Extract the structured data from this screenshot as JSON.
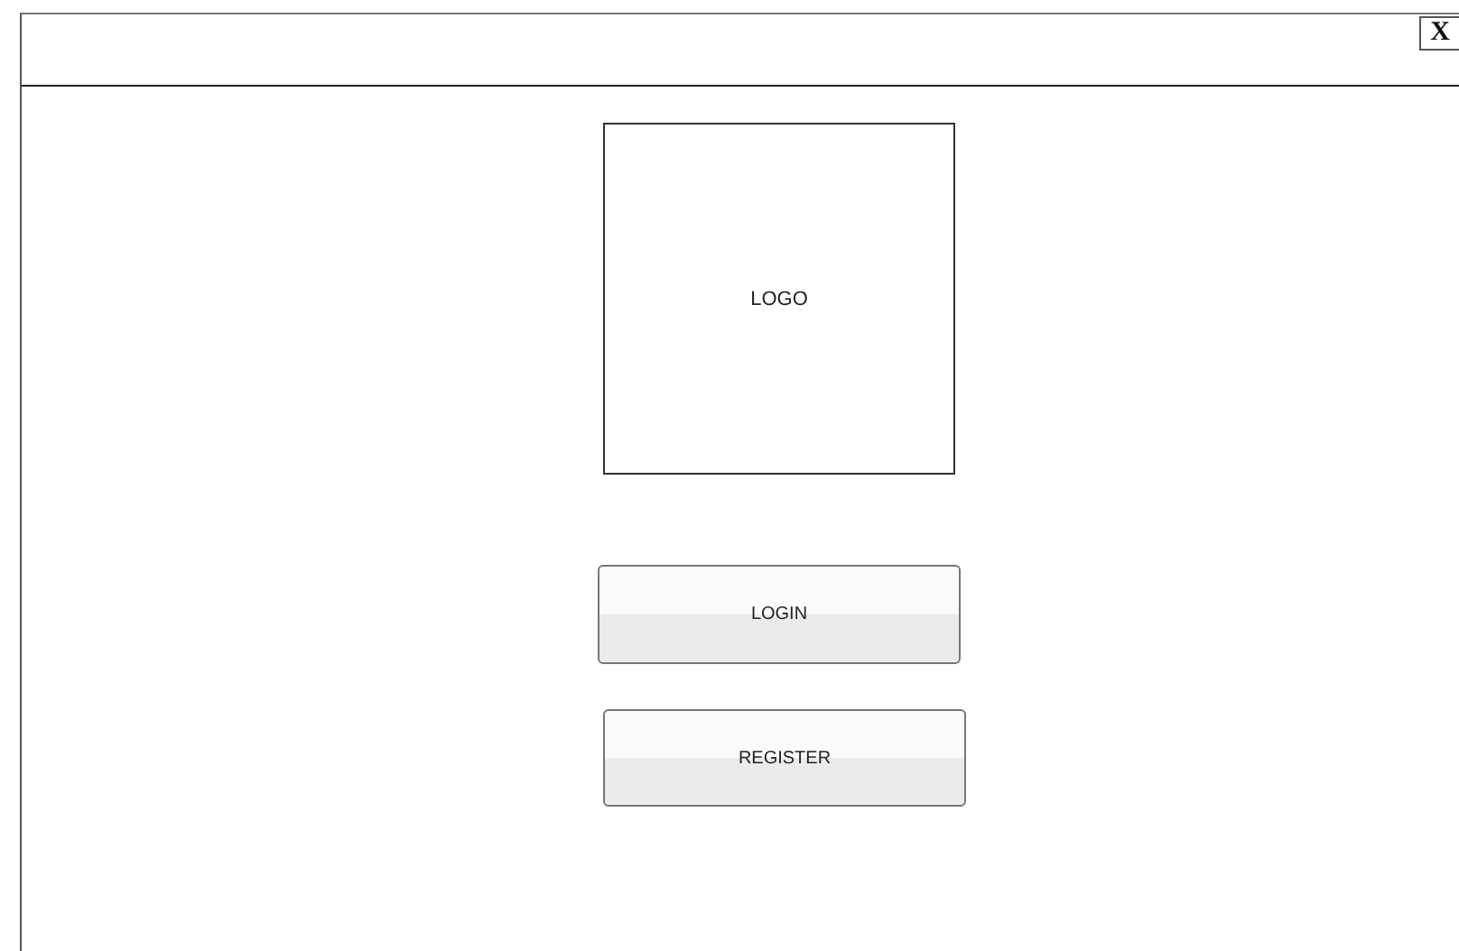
{
  "window": {
    "close_label": "X"
  },
  "logo": {
    "label": "LOGO"
  },
  "buttons": [
    {
      "label": "LOGIN"
    },
    {
      "label": "REGISTER"
    }
  ]
}
